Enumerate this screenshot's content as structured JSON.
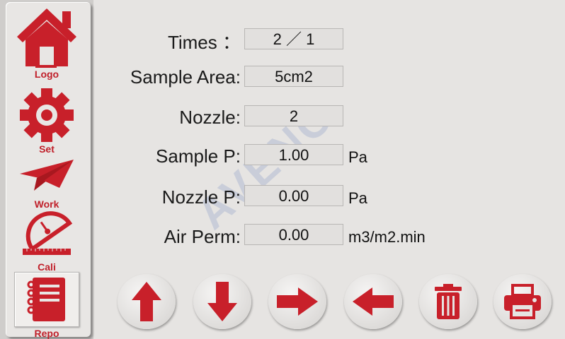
{
  "sidebar": {
    "items": [
      {
        "label": "Logo",
        "icon": "home-icon"
      },
      {
        "label": "Set",
        "icon": "gear-icon"
      },
      {
        "label": "Work",
        "icon": "paper-plane-icon"
      },
      {
        "label": "Cali",
        "icon": "protractor-ruler-icon"
      },
      {
        "label": "Repo",
        "icon": "notebook-icon"
      }
    ]
  },
  "fields": {
    "times": {
      "label": "Times ：",
      "value": "2 ／ 1"
    },
    "sample_area": {
      "label": "Sample Area:",
      "value": "5cm2"
    },
    "nozzle": {
      "label": "Nozzle:",
      "value": "2"
    },
    "sample_p": {
      "label": "Sample P:",
      "value": "1.00",
      "unit": "Pa"
    },
    "nozzle_p": {
      "label": "Nozzle P:",
      "value": "0.00",
      "unit": "Pa"
    },
    "air_perm": {
      "label": "Air Perm:",
      "value": "0.00",
      "unit": "m3/m2.min"
    }
  },
  "watermark": "AVENO",
  "buttons": [
    "arrow-up-icon",
    "arrow-down-icon",
    "arrow-right-icon",
    "arrow-left-icon",
    "trash-icon",
    "printer-icon"
  ],
  "colors": {
    "accent": "#c8202a",
    "background": "#e6e4e2"
  }
}
